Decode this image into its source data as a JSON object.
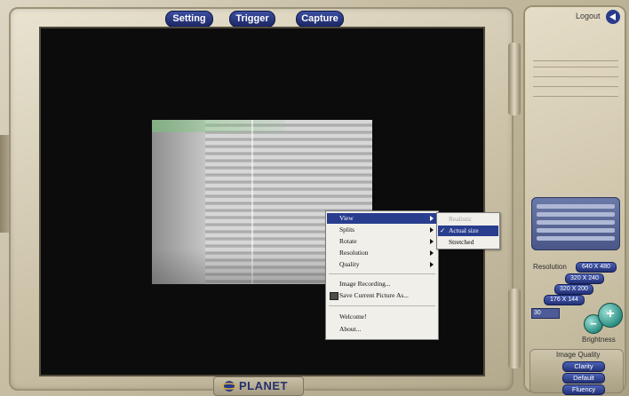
{
  "toolbar": {
    "setting": "Setting",
    "trigger": "Trigger",
    "capture": "Capture"
  },
  "header": {
    "logout": "Logout"
  },
  "brand": {
    "name": "PLANET"
  },
  "context_menu": {
    "items": [
      {
        "label": "View",
        "submenu": true
      },
      {
        "label": "Splits",
        "submenu": true
      },
      {
        "label": "Rotate",
        "submenu": true
      },
      {
        "label": "Resolution",
        "submenu": true
      },
      {
        "label": "Quality",
        "submenu": true
      },
      {
        "label": "Image Recording..."
      },
      {
        "label": "Save Current Picture As..."
      },
      {
        "label": "Welcome!"
      },
      {
        "label": "About..."
      }
    ],
    "view_submenu": [
      {
        "label": "Realistic",
        "disabled": true
      },
      {
        "label": "Actual size",
        "checked": "✓"
      },
      {
        "label": "Stretched"
      }
    ]
  },
  "resolution": {
    "label": "Resolution",
    "options": [
      "640 X 480",
      "320 X 240",
      "320 X 200",
      "176 X 144"
    ]
  },
  "brightness": {
    "label": "Brightness",
    "value": "30",
    "minus": "−",
    "plus": "+"
  },
  "image_quality": {
    "label": "Image Quality",
    "options": [
      "Clarity",
      "Default",
      "Fluency"
    ]
  }
}
